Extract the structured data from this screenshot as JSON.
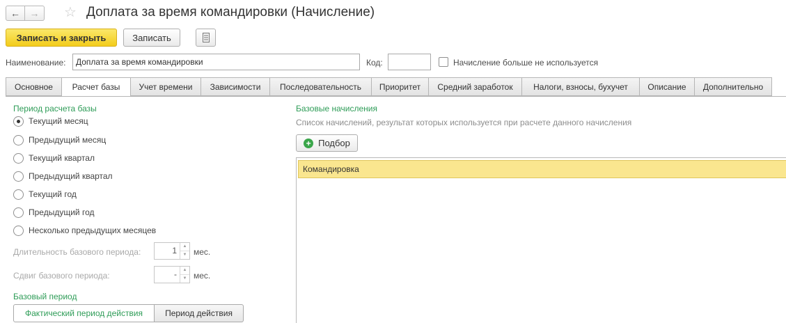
{
  "header": {
    "back_icon": "arrow-left-icon",
    "forward_icon": "arrow-right-icon",
    "favorite_icon": "star-icon",
    "title": "Доплата за время командировки (Начисление)"
  },
  "toolbar": {
    "save_close_label": "Записать и закрыть",
    "save_label": "Записать",
    "report_icon": "document-list-icon"
  },
  "form": {
    "name_label": "Наименование:",
    "name_value": "Доплата за время командировки",
    "code_label": "Код:",
    "code_value": "",
    "unused_label": "Начисление больше не используется",
    "unused_checked": false
  },
  "tabs": [
    {
      "label": "Основное",
      "active": false
    },
    {
      "label": "Расчет базы",
      "active": true
    },
    {
      "label": "Учет времени",
      "active": false
    },
    {
      "label": "Зависимости",
      "active": false
    },
    {
      "label": "Последовательность",
      "active": false
    },
    {
      "label": "Приоритет",
      "active": false
    },
    {
      "label": "Средний заработок",
      "active": false
    },
    {
      "label": "Налоги, взносы, бухучет",
      "active": false
    },
    {
      "label": "Описание",
      "active": false
    },
    {
      "label": "Дополнительно",
      "active": false
    }
  ],
  "period": {
    "title": "Период расчета базы",
    "options": [
      {
        "label": "Текущий месяц",
        "selected": true
      },
      {
        "label": "Предыдущий месяц",
        "selected": false
      },
      {
        "label": "Текущий квартал",
        "selected": false
      },
      {
        "label": "Предыдущий квартал",
        "selected": false
      },
      {
        "label": "Текущий год",
        "selected": false
      },
      {
        "label": "Предыдущий год",
        "selected": false
      },
      {
        "label": "Несколько предыдущих месяцев",
        "selected": false
      }
    ],
    "duration_label": "Длительность базового периода:",
    "duration_value": "1",
    "duration_unit": "мес.",
    "shift_label": "Сдвиг базового периода:",
    "shift_value": "-",
    "shift_unit": "мес."
  },
  "base_period": {
    "title": "Базовый период",
    "actual_label": "Фактический период действия",
    "period_label": "Период действия"
  },
  "accruals": {
    "title": "Базовые начисления",
    "description": "Список начислений, результат которых используется при расчете данного начисления",
    "pick_label": "Подбор",
    "rows": [
      "Командировка"
    ]
  },
  "colors": {
    "primary_button": "#f3cc1b",
    "section_green": "#2e9c57",
    "selected_row": "#fae68f"
  }
}
